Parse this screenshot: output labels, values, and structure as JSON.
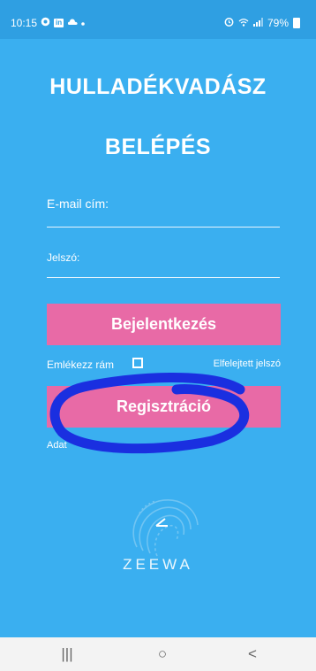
{
  "status_bar": {
    "time": "10:15",
    "left_icons": [
      "whatsapp-icon",
      "linkedin-icon",
      "cloud-icon",
      "dot-icon"
    ],
    "linkedin_glyph": "in",
    "right_icons": [
      "alarm-icon",
      "wifi-icon",
      "signal-icon"
    ],
    "battery": "79%"
  },
  "app": {
    "title": "HULLADÉKVADÁSZ",
    "page_title": "BELÉPÉS"
  },
  "form": {
    "email_label": "E-mail cím:",
    "password_label": "Jelszó:",
    "login_button": "Bejelentkezés",
    "remember_label": "Emlékezz rám",
    "forgot_link": "Elfelejtett jelszó",
    "register_button": "Regisztráció",
    "privacy_link": "Adat"
  },
  "branding": {
    "logo_text": "ZEEWA"
  },
  "nav_bar": {
    "recents": "|||",
    "home": "○",
    "back": "<"
  },
  "colors": {
    "background": "#3aaff0",
    "button": "#e86aa6",
    "scribble": "#1a2fe0"
  }
}
